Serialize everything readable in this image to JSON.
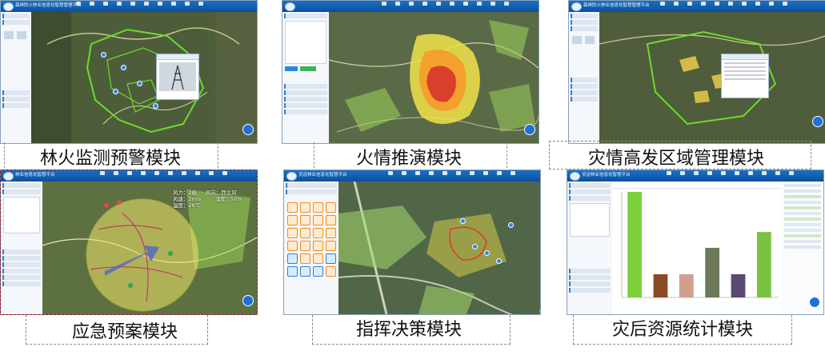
{
  "panels": [
    {
      "id": "fire-monitoring",
      "header": "森林防火林业信息化智慧管理平台",
      "caption": "林火监测预警模块"
    },
    {
      "id": "fire-simulation",
      "header": "",
      "caption": "火情推演模块"
    },
    {
      "id": "high-incidence",
      "header": "森林防火林业信息化智慧管理平台",
      "caption": "灾情高发区域管理模块"
    },
    {
      "id": "emergency-plan",
      "header": "林业信息化智慧平台",
      "caption": "应急预案模块"
    },
    {
      "id": "command-decision",
      "header": "灵运林业信息化智慧平台",
      "caption": "指挥决策模块"
    },
    {
      "id": "post-disaster",
      "header": "灵运林业信息化智慧平台",
      "caption": "灾后资源统计模块"
    }
  ],
  "weather": {
    "line1": "风力：2级  　  风向：西北风",
    "line2": "风速：2m/s　 　 湿度：50%",
    "line3": "温度：26℃"
  },
  "chart_data": {
    "type": "bar",
    "title": "",
    "xlabel": "",
    "ylabel": "",
    "values": [
      100,
      22,
      22,
      47,
      22,
      62
    ],
    "colors": [
      "#7bd03c",
      "#8a4a24",
      "#cfa08e",
      "#6d7a5a",
      "#5a4a72",
      "#7bc243"
    ]
  }
}
